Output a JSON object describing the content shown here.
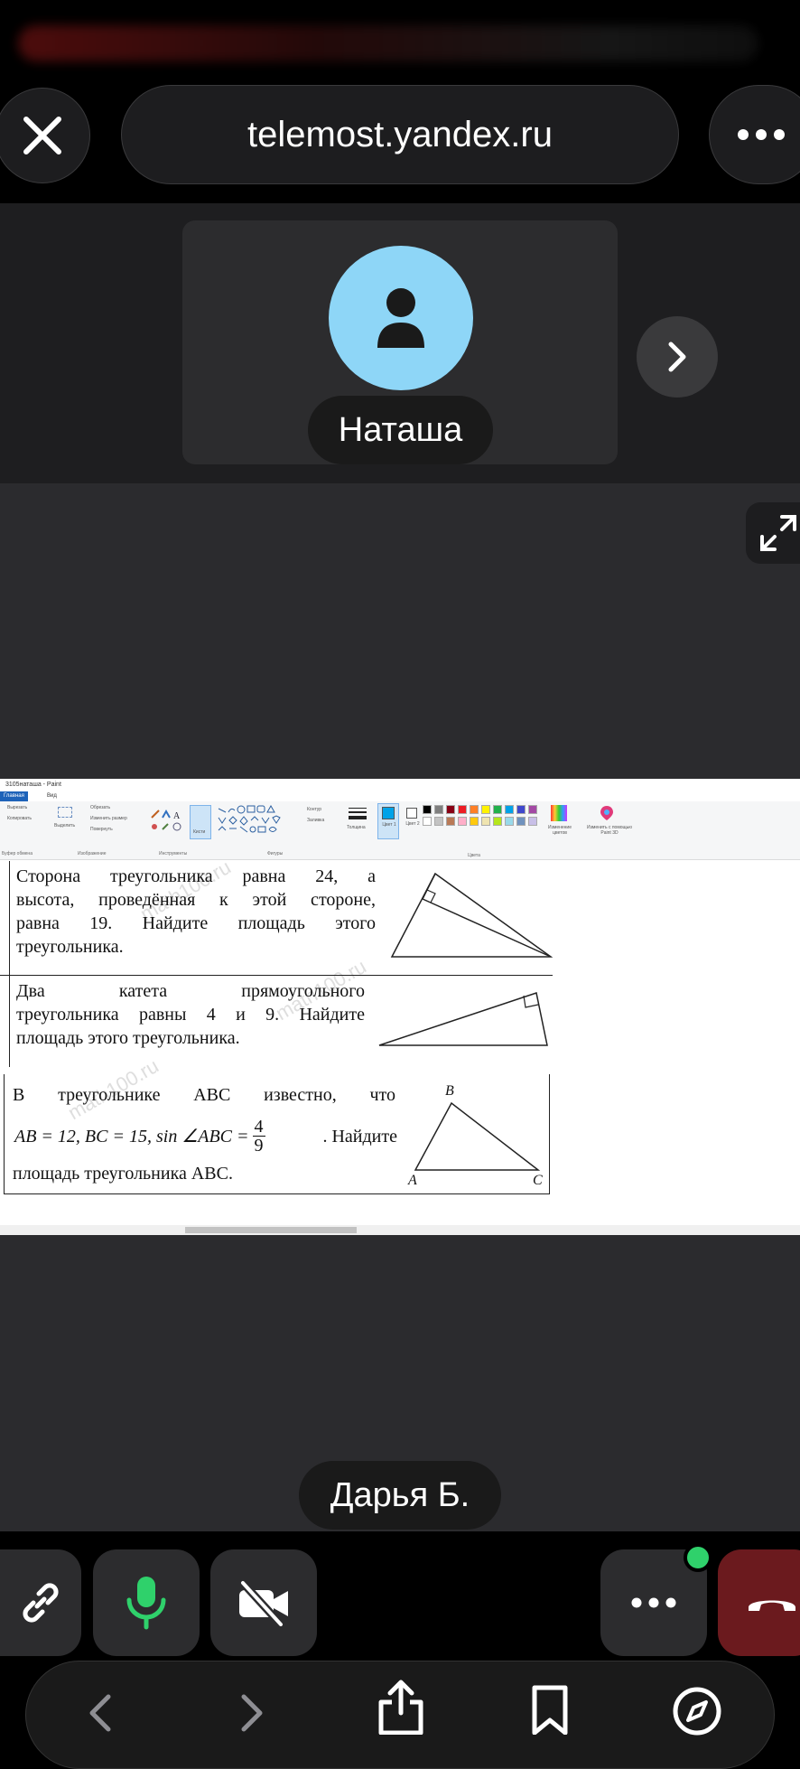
{
  "browser": {
    "url": "telemost.yandex.ru"
  },
  "participants": {
    "top_name": "Наташа",
    "bottom_name": "Дарья Б."
  },
  "paint": {
    "window_title": "3105наташа - Paint",
    "tabs": [
      "Главная",
      "Вид"
    ],
    "clipboard": {
      "cut": "Вырезать",
      "copy": "Копировать",
      "group": "Буфер обмена"
    },
    "image": {
      "select": "Выделить",
      "crop": "Обрезать",
      "resize": "Изменить размер",
      "rotate": "Повернуть",
      "group": "Изображение"
    },
    "tools_group": "Инструменты",
    "brushes": "Кисти",
    "shapes": {
      "outline": "Контур",
      "fill": "Заливка",
      "group": "Фигуры"
    },
    "size": "Толщина",
    "color1": "Цвет 1",
    "color2": "Цвет 2",
    "colors_group": "Цвета",
    "edit_colors": "Изменение цветов",
    "paint3d": "Изменить с помощью Paint 3D",
    "palette": [
      "#000000",
      "#7f7f7f",
      "#880015",
      "#ed1c24",
      "#ff7f27",
      "#fff200",
      "#22b14c",
      "#00a2e8",
      "#3f48cc",
      "#a349a4",
      "#ffffff",
      "#c3c3c3",
      "#b97a57",
      "#ffaec9",
      "#ffc90e",
      "#efe4b0",
      "#b5e61d",
      "#99d9ea",
      "#7092be",
      "#c8bfe7"
    ],
    "problems": [
      {
        "lines": [
          "Сторона треугольника равна 24, а",
          "высота, проведённая к этой стороне,",
          "равна 19. Найдите площадь этого",
          "треугольника."
        ]
      },
      {
        "lines": [
          "Два катета прямоугольного",
          "треугольника равны 4 и 9. Найдите",
          "площадь этого треугольника."
        ]
      },
      {
        "line1": "В треугольнике ABC известно, что",
        "line2a": "AB = 12,  BC = 15,  sin ∠ABC =",
        "frac_num": "4",
        "frac_den": "9",
        "line2b": ". Найдите",
        "line3": "площадь треугольника ABC.",
        "labels": {
          "a": "A",
          "b": "B",
          "c": "C"
        }
      }
    ],
    "watermark": "math100.ru"
  },
  "colors": {
    "avatar": "#8ed6f7",
    "mic_on": "#2fd16b",
    "end_call": "#6b1a1e",
    "badge": "#2fd16b"
  }
}
